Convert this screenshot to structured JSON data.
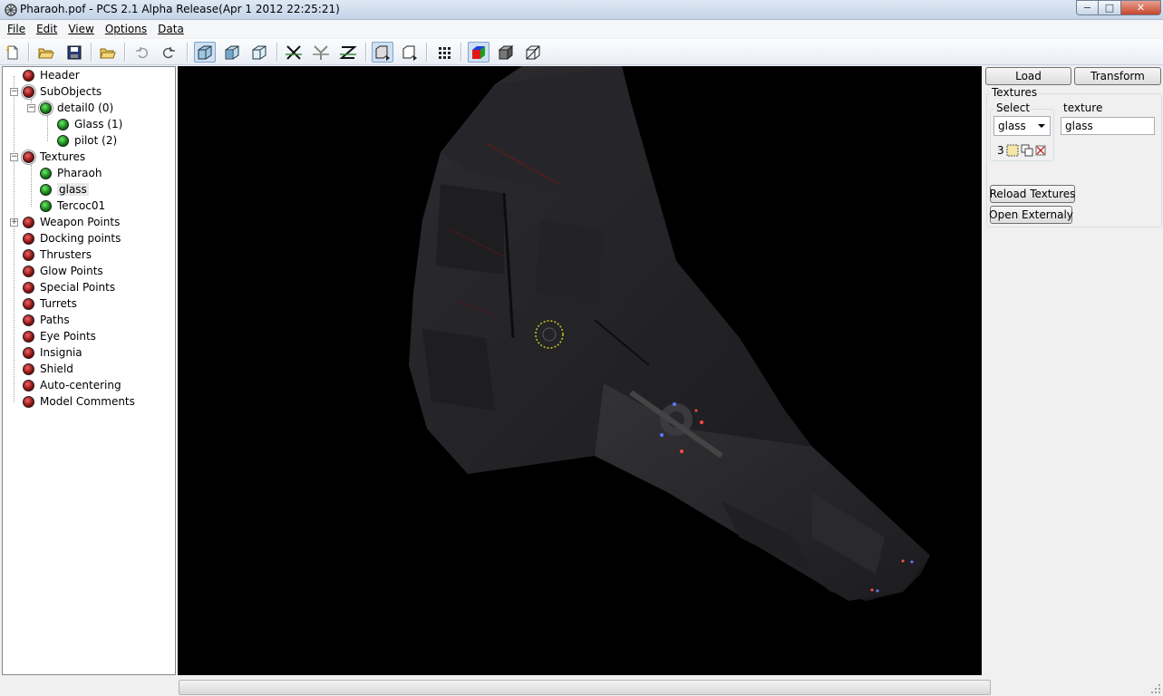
{
  "window": {
    "title": "Pharaoh.pof - PCS 2.1 Alpha Release(Apr  1 2012 22:25:21)",
    "min_label": "−",
    "max_label": "□",
    "close_label": "✕"
  },
  "menu": {
    "items": [
      {
        "label": "File"
      },
      {
        "label": "Edit"
      },
      {
        "label": "View"
      },
      {
        "label": "Options"
      },
      {
        "label": "Data"
      }
    ]
  },
  "toolbar": {
    "buttons": [
      "new-icon",
      "open-icon",
      "save-icon",
      "open-folder-icon",
      "undo-icon",
      "redo-icon",
      "solid-view-icon",
      "textured-view-icon",
      "wireframe-view-icon",
      "mirror-x-icon",
      "mirror-y-icon",
      "mirror-z-icon",
      "lod-icon",
      "lod-next-icon",
      "grid-icon",
      "color-icon",
      "cube-shaded-icon",
      "cube-wire-icon"
    ]
  },
  "tree": {
    "items": [
      {
        "label": "Header"
      },
      {
        "label": "SubObjects"
      },
      {
        "label": "detail0 (0)"
      },
      {
        "label": "Glass (1)"
      },
      {
        "label": "pilot (2)"
      },
      {
        "label": "Textures"
      },
      {
        "label": "Pharaoh"
      },
      {
        "label": "glass"
      },
      {
        "label": "Tercoc01"
      },
      {
        "label": "Weapon Points"
      },
      {
        "label": "Docking points"
      },
      {
        "label": "Thrusters"
      },
      {
        "label": "Glow Points"
      },
      {
        "label": "Special Points"
      },
      {
        "label": "Turrets"
      },
      {
        "label": "Paths"
      },
      {
        "label": "Eye Points"
      },
      {
        "label": "Insignia"
      },
      {
        "label": "Shield"
      },
      {
        "label": "Auto-centering"
      },
      {
        "label": "Model Comments"
      }
    ]
  },
  "panel": {
    "load_label": "Load",
    "transform_label": "Transform",
    "group_title": "Textures",
    "select_label": "Select",
    "select_value": "glass",
    "texture_label": "texture",
    "texture_value": "glass",
    "image_count": "3",
    "reload_label": "Reload Textures",
    "open_external_label": "Open Externaly"
  },
  "colors": {
    "viewport_bg": "#000000",
    "node_red": "#8a0f0f",
    "node_green": "#137813"
  }
}
